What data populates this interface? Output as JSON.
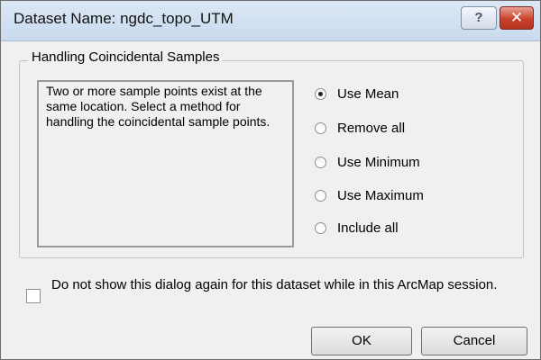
{
  "window": {
    "title": "Dataset Name: ngdc_topo_UTM",
    "help_glyph": "?",
    "close_glyph": "✕"
  },
  "group": {
    "legend": "Handling Coincidental Samples",
    "description": "Two or more sample points exist at the same location. Select a method for handling the coincidental sample points."
  },
  "options": [
    {
      "label": "Use Mean",
      "selected": true
    },
    {
      "label": "Remove all",
      "selected": false
    },
    {
      "label": "Use Minimum",
      "selected": false
    },
    {
      "label": "Use Maximum",
      "selected": false
    },
    {
      "label": "Include all",
      "selected": false
    }
  ],
  "checkbox": {
    "label": "Do not show this dialog again for this dataset while in this ArcMap session.",
    "checked": false
  },
  "buttons": {
    "ok": "OK",
    "cancel": "Cancel"
  }
}
